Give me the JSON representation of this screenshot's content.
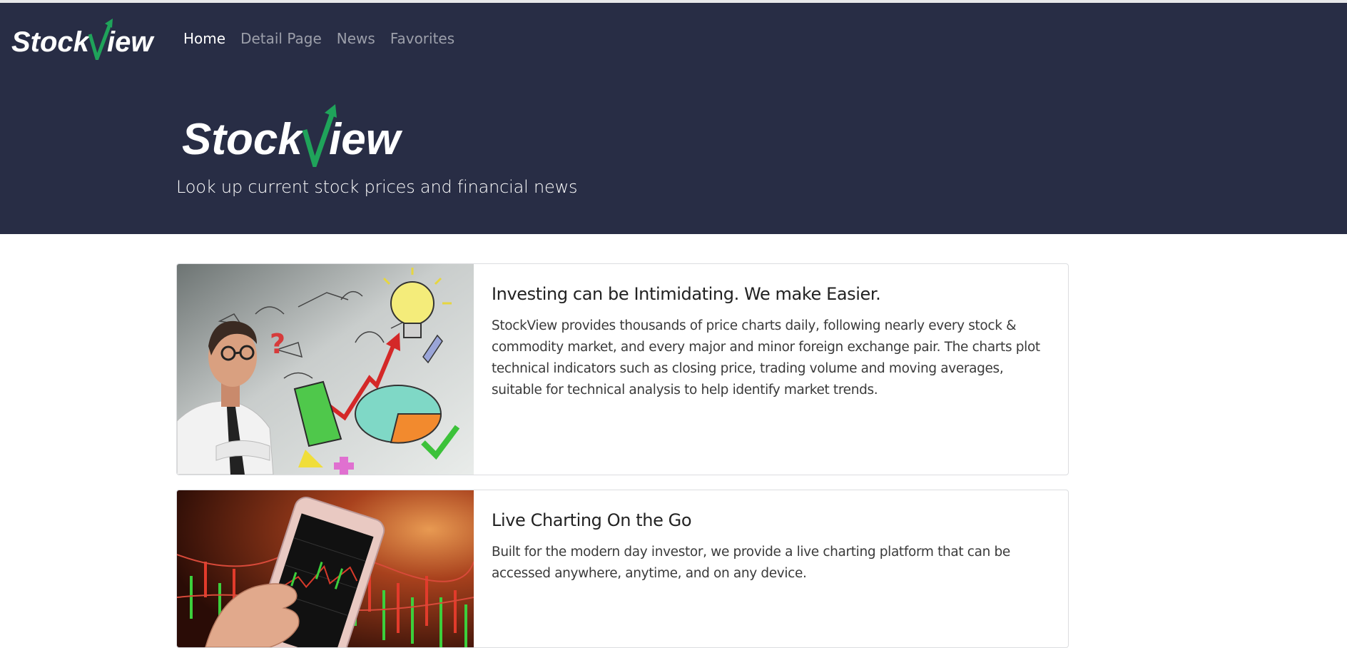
{
  "nav": {
    "brand": {
      "part1": "Stock",
      "part2": "iew"
    },
    "items": [
      {
        "label": "Home",
        "active": true
      },
      {
        "label": "Detail Page",
        "active": false
      },
      {
        "label": "News",
        "active": false
      },
      {
        "label": "Favorites",
        "active": false
      }
    ]
  },
  "hero": {
    "logo": {
      "part1": "Stock",
      "part2": "iew"
    },
    "tagline": "Look up current stock prices and financial news"
  },
  "cards": [
    {
      "title": "Investing can be Intimidating. We make Easier.",
      "text": "StockView provides thousands of price charts daily, following nearly every stock & commodity market, and every major and minor foreign exchange pair. The charts plot technical indicators such as closing price, trading volume and moving averages, suitable for technical analysis to help identify market trends."
    },
    {
      "title": "Live Charting On the Go",
      "text": "Built for the modern day investor, we provide a live charting platform that can be accessed anywhere, anytime, and on any device."
    }
  ],
  "colors": {
    "header_bg": "#282d45",
    "logo_green": "#1fa35a",
    "nav_active": "#ffffff",
    "nav_inactive": "#9c9faa"
  },
  "icons": [
    "stockview-logo",
    "rising-arrow-icon"
  ]
}
